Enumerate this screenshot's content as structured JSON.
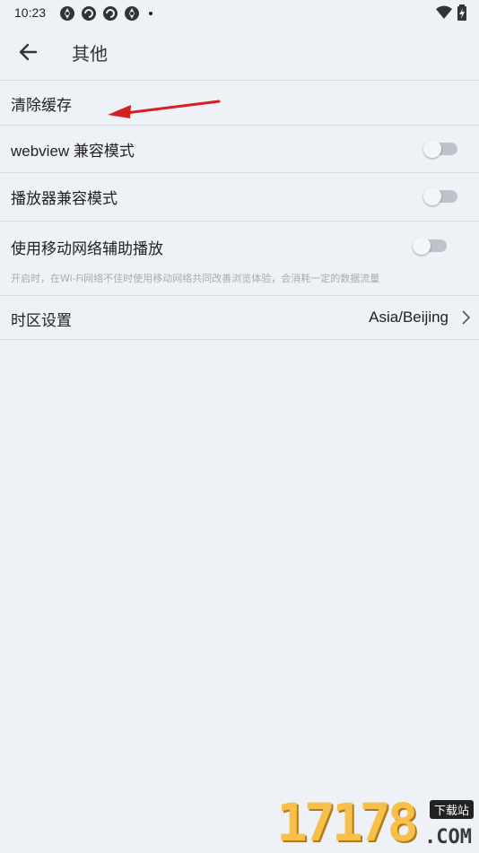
{
  "status_bar": {
    "time": "10:23",
    "icons": [
      "aperture-icon",
      "sync-icon",
      "sync-icon",
      "aperture-icon"
    ],
    "right_icons": [
      "wifi-icon",
      "battery-charging-icon"
    ]
  },
  "header": {
    "back_icon": "arrow-left-icon",
    "title": "其他"
  },
  "settings": {
    "clear_cache": {
      "label": "清除缓存"
    },
    "webview_compat": {
      "label": "webview 兼容模式",
      "enabled": false
    },
    "player_compat": {
      "label": "播放器兼容模式",
      "enabled": false
    },
    "mobile_assist": {
      "label": "使用移动网络辅助播放",
      "description": "开启时，在Wi-Fi网络不佳时使用移动网络共同改善浏览体验，会消耗一定的数据流量",
      "enabled": false
    },
    "timezone": {
      "label": "时区设置",
      "value": "Asia/Beijing"
    }
  },
  "annotation": {
    "color": "#d42020"
  },
  "watermark": {
    "digits": "17178",
    "badge": "下载站",
    "domain": ".COM"
  }
}
